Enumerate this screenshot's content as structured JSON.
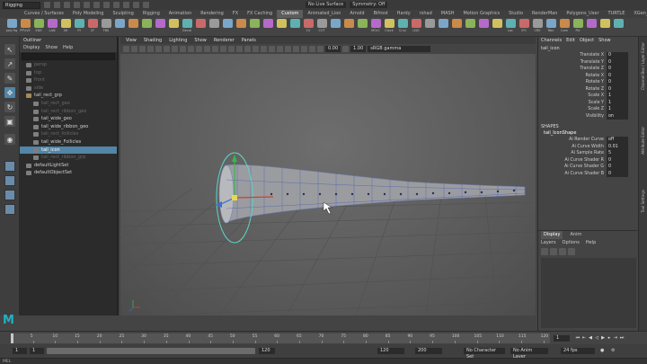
{
  "status_line": {
    "mode": "Rigging",
    "live_surface": "No Live Surface",
    "symmetry": "Symmetry: Off"
  },
  "shelf": {
    "tabs": [
      "Curves / Surfaces",
      "Poly Modeling",
      "Sculpting",
      "Rigging",
      "Animation",
      "Rendering",
      "FX",
      "FX Caching",
      "Custom",
      "Animated_Lion",
      "Arnold",
      "Bifrost",
      "Hardy",
      "rshad",
      "MASH",
      "Motion Graphics",
      "Studio",
      "RenderMan",
      "Polygons_User",
      "TURTLE",
      "XGen_"
    ],
    "active_tab": "Custom",
    "buttons": [
      "polyTrg",
      "PPUVE",
      "EDE",
      "LAN",
      "SH",
      "YY",
      "CF",
      "FBS",
      "",
      "",
      "",
      "",
      "",
      "Decal",
      "",
      "",
      "",
      "",
      "",
      "",
      "",
      "",
      "CV",
      "CVT",
      "",
      "",
      "",
      "MOrC",
      "Clock",
      "Crvy",
      "LNG",
      "",
      "",
      "",
      "",
      "",
      "",
      "Loc",
      "IFS",
      "CRE",
      "Rbx",
      "Cam",
      "Pill",
      "",
      "",
      ""
    ]
  },
  "toolbox": {
    "tools": [
      "select-tool",
      "lasso-tool",
      "paint-select-tool",
      "move-tool",
      "rotate-tool",
      "scale-tool"
    ]
  },
  "outliner": {
    "title": "Outliner",
    "menu": [
      "Display",
      "Show",
      "Help"
    ],
    "rows": [
      {
        "label": "persp",
        "state": "dim",
        "indent": 0
      },
      {
        "label": "top",
        "state": "dim",
        "indent": 0
      },
      {
        "label": "front",
        "state": "dim",
        "indent": 0
      },
      {
        "label": "side",
        "state": "dim",
        "indent": 0
      },
      {
        "label": "tail_rect_grp",
        "state": "normal",
        "indent": 0,
        "group": true
      },
      {
        "label": "tail_rect_geo",
        "state": "dim",
        "indent": 1
      },
      {
        "label": "tail_rect_ribbon_geo",
        "state": "dim",
        "indent": 1
      },
      {
        "label": "tail_wide_geo",
        "state": "normal",
        "indent": 1
      },
      {
        "label": "tail_wide_ribbon_geo",
        "state": "normal",
        "indent": 1
      },
      {
        "label": "tail_rect_follicles",
        "state": "dim",
        "indent": 1
      },
      {
        "label": "tail_wide_Follicles",
        "state": "normal",
        "indent": 1
      },
      {
        "label": "tail_icon",
        "state": "selected",
        "indent": 1
      },
      {
        "label": "tail_rect_ribbon_grp",
        "state": "dim",
        "indent": 1
      },
      {
        "label": "defaultLightSet",
        "state": "normal",
        "indent": 0
      },
      {
        "label": "defaultObjectSet",
        "state": "normal",
        "indent": 0
      }
    ]
  },
  "viewport": {
    "menu": [
      "View",
      "Shading",
      "Lighting",
      "Show",
      "Renderer",
      "Panels"
    ],
    "exposure": "0.00",
    "gamma": "1.00",
    "colorspace": "sRGB gamma"
  },
  "channel_box": {
    "tabs": [
      "Channels",
      "Edit",
      "Object",
      "Show"
    ],
    "node": "tail_icon",
    "attributes": [
      {
        "name": "Translate X",
        "value": "0"
      },
      {
        "name": "Translate Y",
        "value": "0"
      },
      {
        "name": "Translate Z",
        "value": "0"
      },
      {
        "name": "Rotate X",
        "value": "0"
      },
      {
        "name": "Rotate Y",
        "value": "0"
      },
      {
        "name": "Rotate Z",
        "value": "0"
      },
      {
        "name": "Scale X",
        "value": "1"
      },
      {
        "name": "Scale Y",
        "value": "1"
      },
      {
        "name": "Scale Z",
        "value": "1"
      },
      {
        "name": "Visibility",
        "value": "on"
      }
    ],
    "shapes_header": "SHAPES",
    "shape_name": "tail_IconShape",
    "shape_attributes": [
      {
        "name": "Ai Render Curve",
        "value": "off"
      },
      {
        "name": "Ai Curve Width",
        "value": "0.01"
      },
      {
        "name": "Ai Sample Rate",
        "value": "5"
      },
      {
        "name": "Ai Curve Shader R",
        "value": "0"
      },
      {
        "name": "Ai Curve Shader G",
        "value": "0"
      },
      {
        "name": "Ai Curve Shader B",
        "value": "0"
      }
    ]
  },
  "layer_editor": {
    "tabs": [
      "Display",
      "Anim"
    ],
    "active_tab": "Display",
    "menu": [
      "Layers",
      "Options",
      "Help"
    ]
  },
  "side_strip": {
    "labels": [
      "Channel Box / Layer Editor",
      "Attribute Editor",
      "Tool Settings"
    ]
  },
  "timeline": {
    "ticks": [
      "5",
      "10",
      "15",
      "20",
      "25",
      "30",
      "35",
      "40",
      "45",
      "50",
      "55",
      "60",
      "65",
      "70",
      "75",
      "80",
      "85",
      "90",
      "95",
      "100",
      "105",
      "110",
      "115",
      "120"
    ],
    "current_frame": "1",
    "current_frame_fraction": 0
  },
  "range": {
    "start": "1",
    "inner_start": "1",
    "inner_end": "120",
    "end": "120",
    "anim_end": "200",
    "character_set": "No Character Set",
    "anim_layer": "No Anim Layer",
    "fps": "24 fps"
  },
  "command_line": {
    "label": "MEL"
  },
  "logo": "M"
}
